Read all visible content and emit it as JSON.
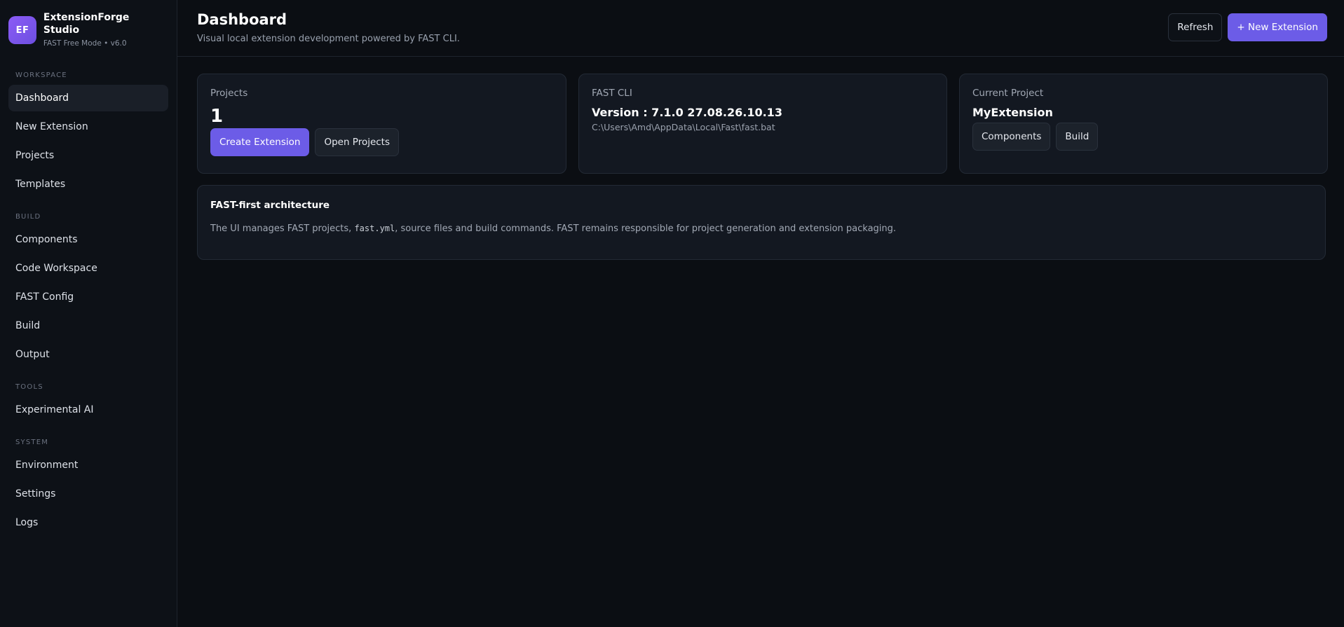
{
  "brand": {
    "logo_text": "EF",
    "name": "ExtensionForge Studio",
    "subtitle": "FAST Free Mode • v6.0",
    "accent_color": "#7c5cf0"
  },
  "sidebar": {
    "sections": [
      {
        "title": "WORKSPACE",
        "items": [
          "Dashboard",
          "New Extension",
          "Projects",
          "Templates"
        ]
      },
      {
        "title": "BUILD",
        "items": [
          "Components",
          "Code Workspace",
          "FAST Config",
          "Build",
          "Output"
        ]
      },
      {
        "title": "TOOLS",
        "items": [
          "Experimental AI"
        ]
      },
      {
        "title": "SYSTEM",
        "items": [
          "Environment",
          "Settings",
          "Logs"
        ]
      }
    ],
    "active_item": "Dashboard"
  },
  "header": {
    "title": "Dashboard",
    "subtitle": "Visual local extension development powered by FAST CLI.",
    "refresh_label": "Refresh",
    "new_extension_label": "+ New Extension"
  },
  "cards": {
    "projects": {
      "label": "Projects",
      "count": "1",
      "create_label": "Create Extension",
      "open_label": "Open Projects"
    },
    "fast_cli": {
      "label": "FAST CLI",
      "version": "Version : 7.1.0 27.08.26.10.13",
      "path": "C:\\Users\\Amd\\AppData\\Local\\Fast\\fast.bat"
    },
    "current_project": {
      "label": "Current Project",
      "name": "MyExtension",
      "components_label": "Components",
      "build_label": "Build"
    }
  },
  "info": {
    "title": "FAST-first architecture",
    "text_before": "The UI manages FAST projects, ",
    "code": "fast.yml",
    "text_after": ", source files and build commands. FAST remains responsible for project generation and extension packaging."
  }
}
